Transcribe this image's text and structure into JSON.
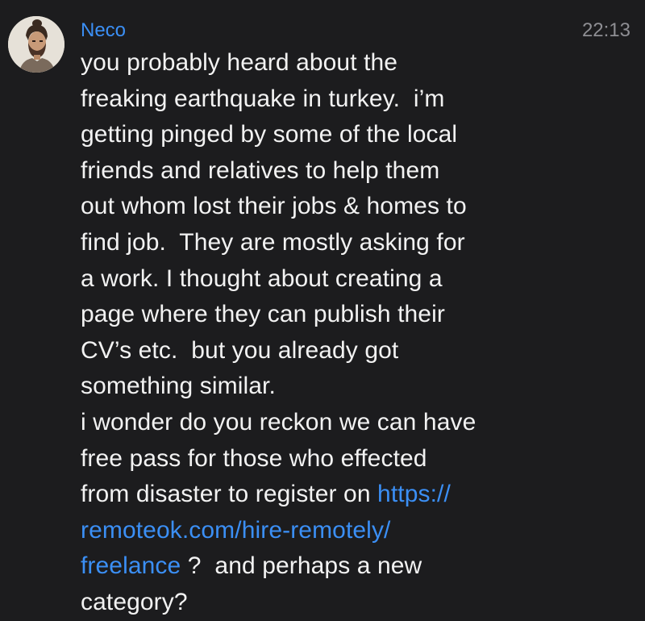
{
  "message": {
    "sender": "Neco",
    "time": "22:13",
    "avatar_icon": "user-avatar-photo",
    "text_before_link": "you probably heard about the\nfreaking earthquake in turkey.  i’m\ngetting pinged by some of the local\nfriends and relatives to help them\nout whom lost their jobs & homes to\nfind job.  They are mostly asking for\na work. I thought about creating a\npage where they can publish their\nCV’s etc.  but you already got\nsomething similar.\ni wonder do you reckon we can have\nfree pass for those who effected\nfrom disaster to register on ",
    "link_text": "https://\nremoteok.com/hire-remotely/\nfreelance",
    "text_after_link": " ?  and perhaps a new\ncategory?"
  },
  "colors": {
    "background": "#1c1c1e",
    "sender_name": "#3b8ff5",
    "link": "#3b8ff5",
    "body_text": "#f2f2f2",
    "timestamp": "#8e8e93"
  }
}
